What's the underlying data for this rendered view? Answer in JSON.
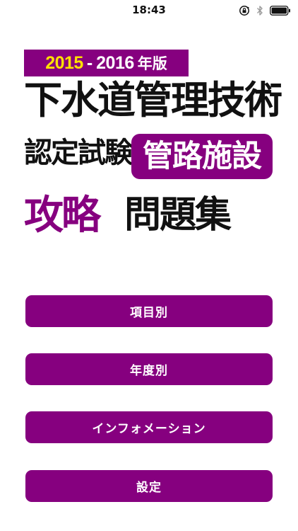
{
  "status_bar": {
    "time": "18:43",
    "icons": [
      "rotation-lock-icon",
      "bluetooth-icon",
      "battery-icon"
    ]
  },
  "title": {
    "year_start": "2015",
    "year_separator": "-",
    "year_end": "2016",
    "year_suffix": "年版",
    "line1": "下水道管理技術",
    "line2": "認定試験",
    "line2_highlight": "管路施設",
    "line3_highlight": "攻略",
    "line3": "問題集"
  },
  "menu": {
    "items": [
      {
        "label": "項目別"
      },
      {
        "label": "年度別"
      },
      {
        "label": "インフォメーション"
      },
      {
        "label": "設定"
      }
    ]
  },
  "colors": {
    "accent": "#86007f",
    "year_highlight": "#ffe100",
    "background": "#ffffff",
    "text": "#111111"
  }
}
